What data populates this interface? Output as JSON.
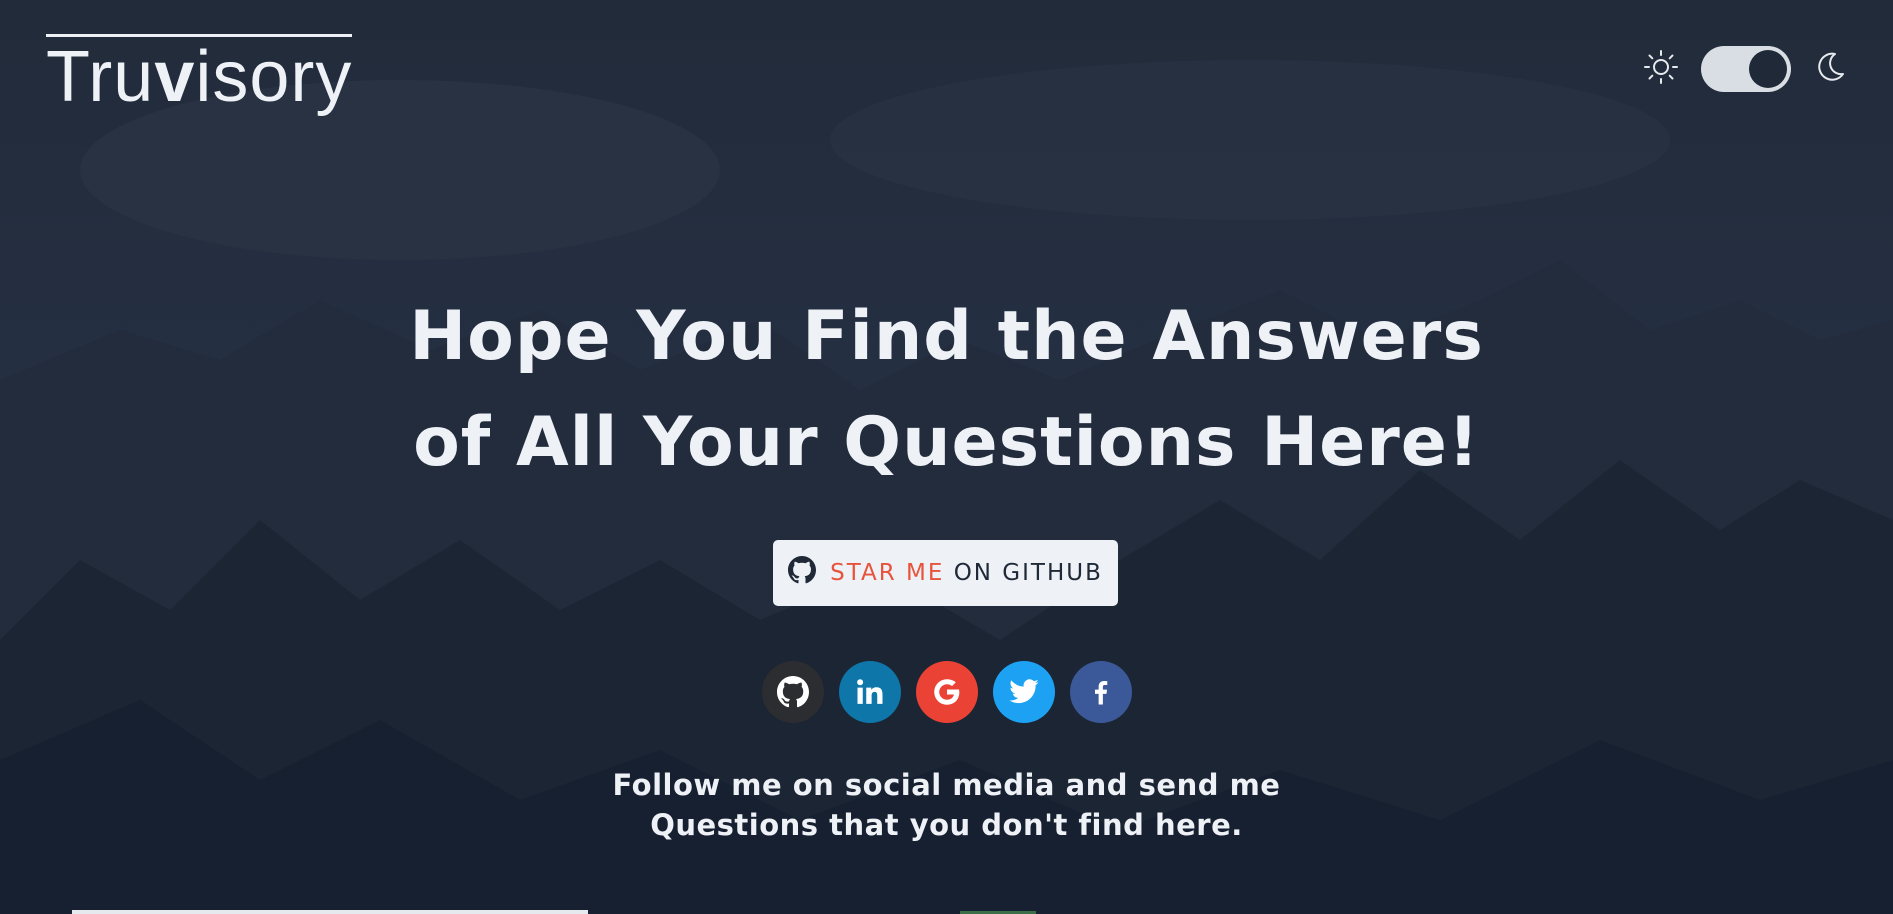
{
  "brand": {
    "logo_prefix": "Tru",
    "logo_bold": "v",
    "logo_suffix": "isory"
  },
  "theme_toggle": {
    "light_icon": "sun-icon",
    "dark_icon": "moon-icon",
    "state": "dark"
  },
  "hero": {
    "line1": "Hope You Find the Answers",
    "line2": "of All Your Questions Here!"
  },
  "github_button": {
    "icon": "github-icon",
    "highlight": "STAR ME",
    "rest": "ON GITHUB"
  },
  "socials": [
    {
      "name": "github",
      "icon": "github-icon",
      "color": "#2b2d31"
    },
    {
      "name": "linkedin",
      "icon": "linkedin-icon",
      "color": "#0e76a8"
    },
    {
      "name": "google",
      "icon": "google-icon",
      "color": "#ea4335"
    },
    {
      "name": "twitter",
      "icon": "twitter-icon",
      "color": "#1da1f2"
    },
    {
      "name": "facebook",
      "icon": "facebook-icon",
      "color": "#3b5998"
    }
  ],
  "follow": {
    "line1": "Follow me on social media and send me",
    "line2": "Questions that you don't find here."
  },
  "colors": {
    "accent": "#e8543b",
    "text": "#eef1f6",
    "background": "#1b2435"
  }
}
